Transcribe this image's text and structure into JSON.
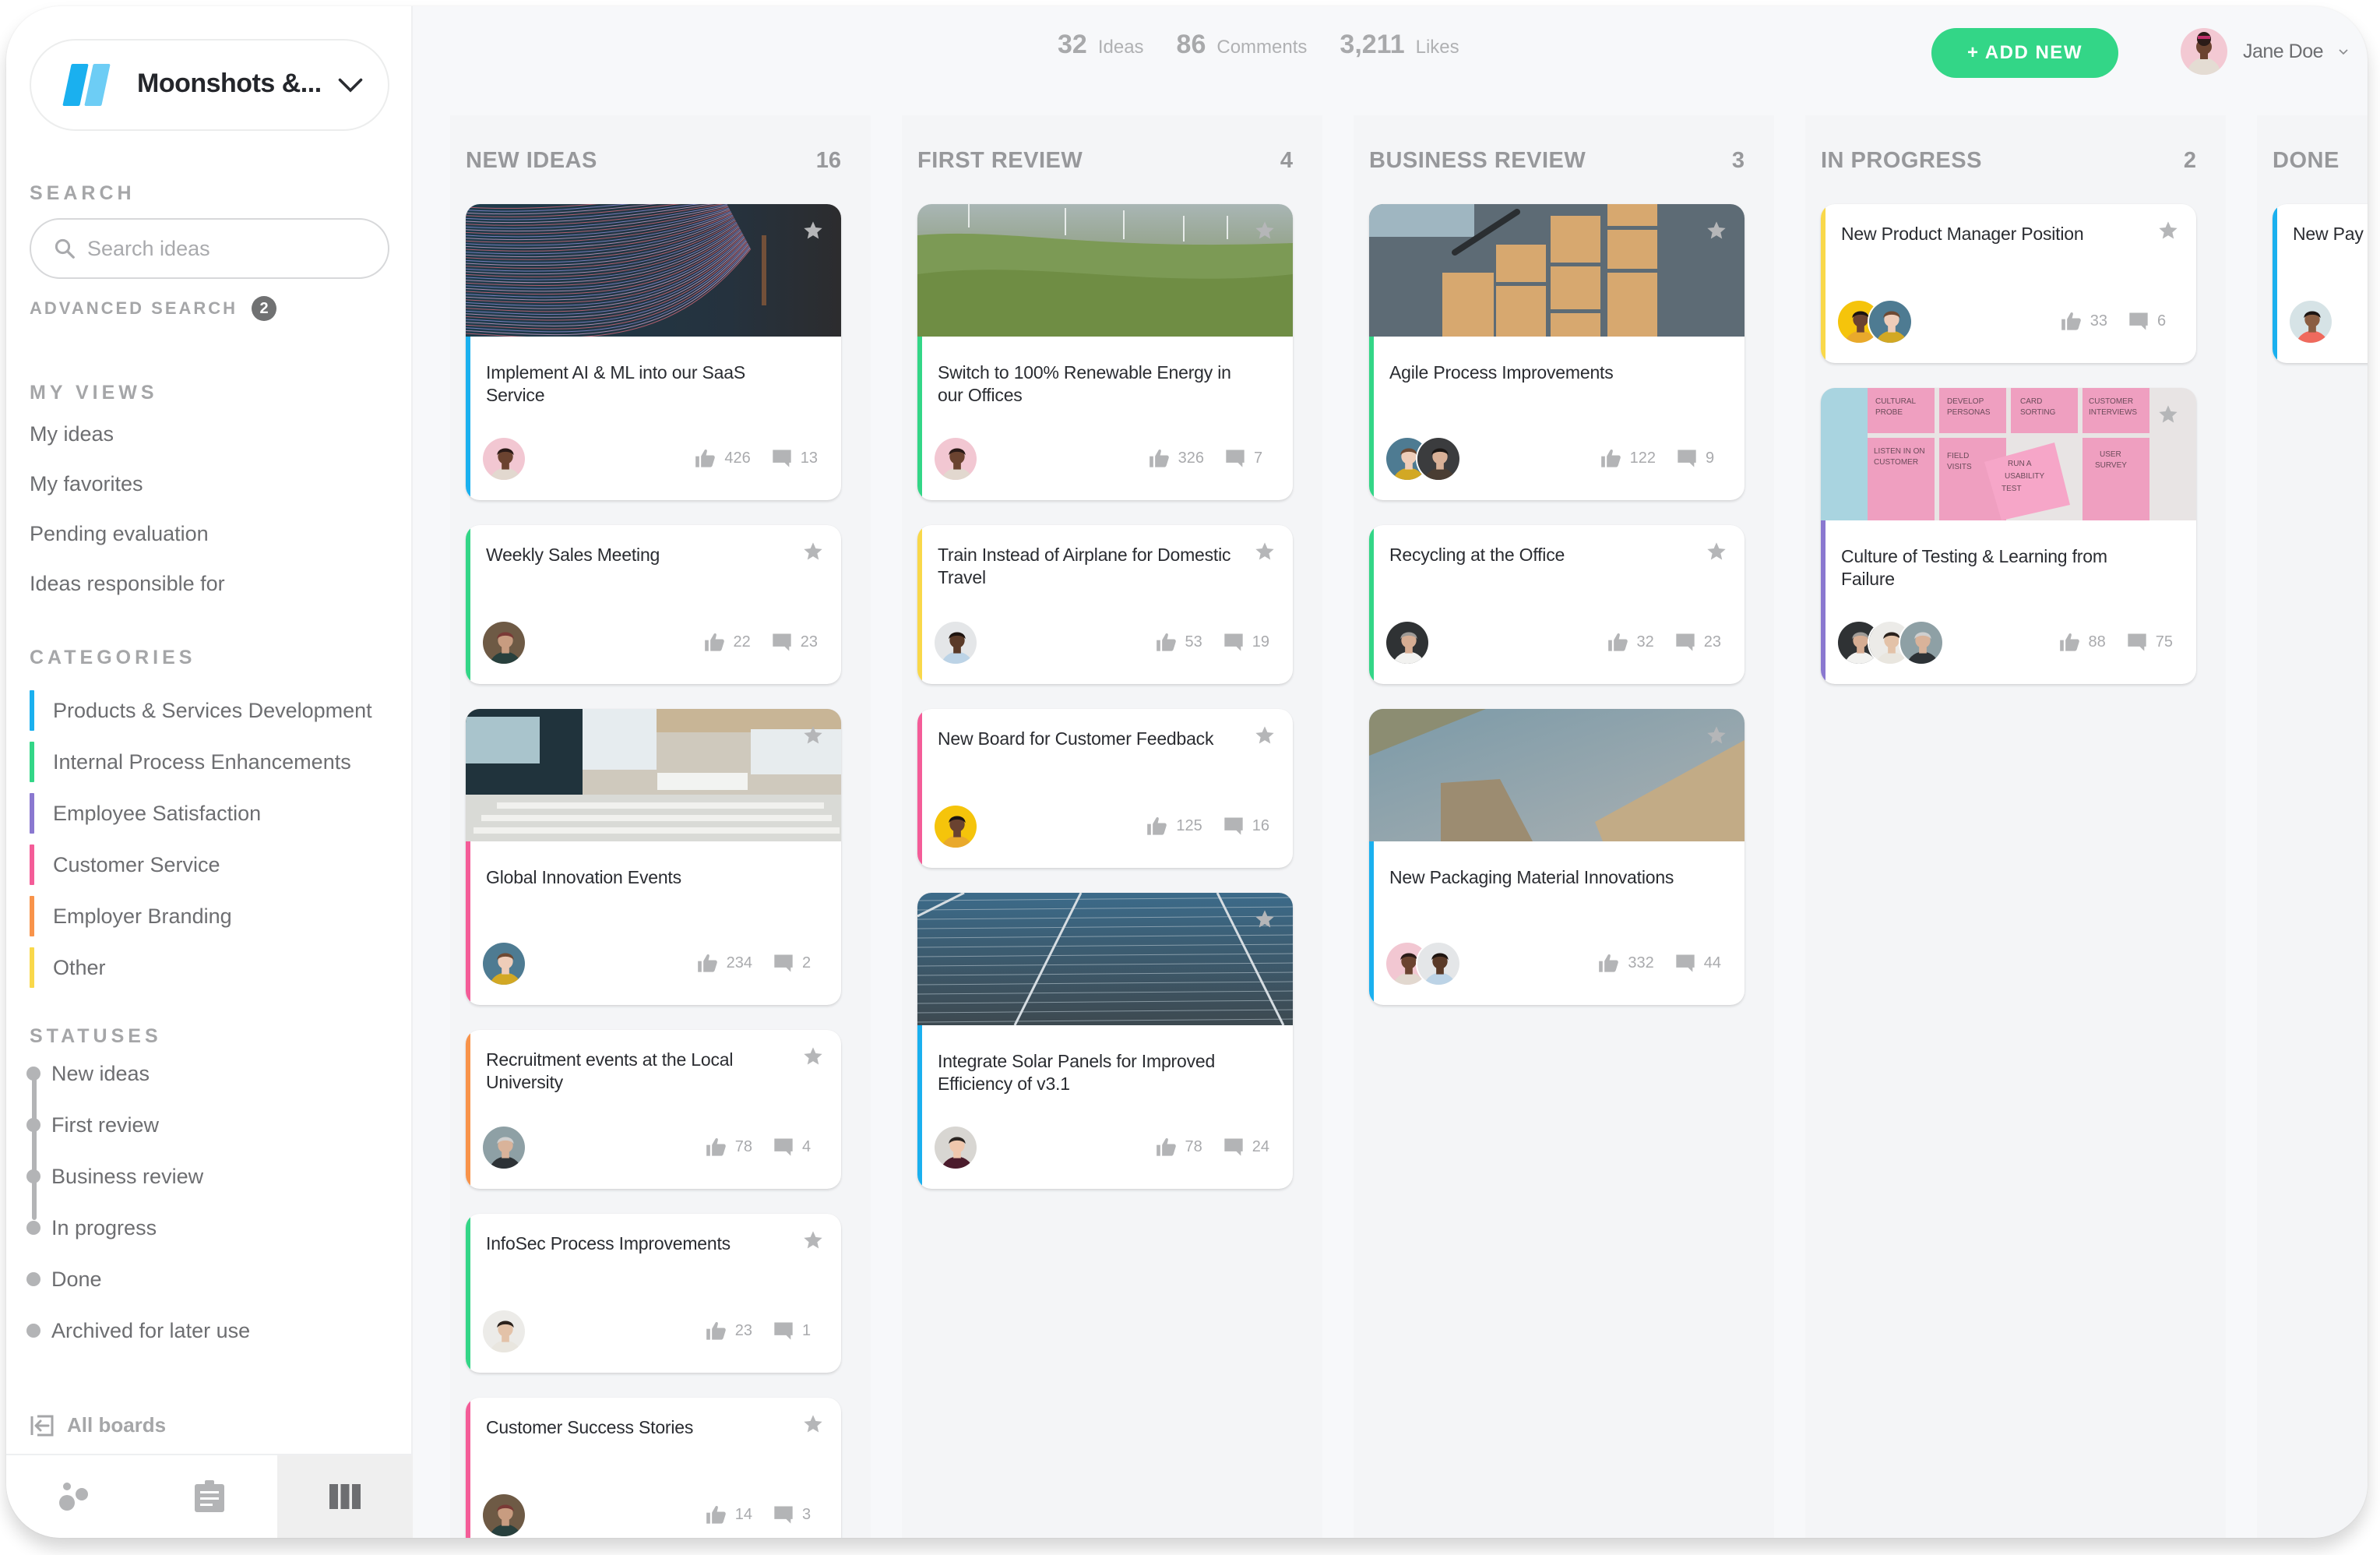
{
  "board": {
    "name": "Moonshots &...",
    "logo_colors": [
      "#1ab0ef",
      "#6dcdf5"
    ]
  },
  "sidebar": {
    "search_heading": "SEARCH",
    "search_placeholder": "Search ideas",
    "search_value": "",
    "advanced_search_label": "ADVANCED SEARCH",
    "advanced_search_count": "2",
    "views_heading": "MY VIEWS",
    "views": [
      "My ideas",
      "My favorites",
      "Pending evaluation",
      "Ideas responsible for"
    ],
    "categories_heading": "CATEGORIES",
    "categories": [
      {
        "label": "Products & Services Development",
        "color": "#1ab0ef"
      },
      {
        "label": "Internal Process Enhancements",
        "color": "#33d687"
      },
      {
        "label": "Employee Satisfaction",
        "color": "#8a78d0"
      },
      {
        "label": "Customer Service",
        "color": "#f45c98"
      },
      {
        "label": "Employer Branding",
        "color": "#f8934a"
      },
      {
        "label": "Other",
        "color": "#f9d84a"
      }
    ],
    "statuses_heading": "STATUSES",
    "statuses": [
      "New ideas",
      "First review",
      "Business review",
      "In progress",
      "Done",
      "Archived for later use"
    ],
    "all_boards_label": "All boards",
    "bottom_tabs": [
      {
        "icon": "community-icon",
        "active": false
      },
      {
        "icon": "clipboard-icon",
        "active": false
      },
      {
        "icon": "board-columns-icon",
        "active": true
      }
    ]
  },
  "topbar": {
    "stats": [
      {
        "value": "32",
        "label": "Ideas"
      },
      {
        "value": "86",
        "label": "Comments"
      },
      {
        "value": "3,211",
        "label": "Likes"
      }
    ],
    "add_new_label": "+ ADD NEW",
    "add_new_color": "#33d687",
    "user_name": "Jane Doe"
  },
  "columns": [
    {
      "title": "NEW IDEAS",
      "count": "16",
      "cards": [
        {
          "title": "Implement AI & ML into our SaaS Service",
          "category_color": "#1ab0ef",
          "image": "abstract-light-lines",
          "likes": "426",
          "comments": "13",
          "avatars": [
            "woman-pink-bg"
          ]
        },
        {
          "title": "Weekly Sales Meeting",
          "category_color": "#33d687",
          "image": null,
          "likes": "22",
          "comments": "23",
          "avatars": [
            "man-beanie"
          ]
        },
        {
          "title": "Global Innovation Events",
          "category_color": "#f45c98",
          "image": "conference-hall",
          "likes": "234",
          "comments": "2",
          "avatars": [
            "woman-blue-bg"
          ]
        },
        {
          "title": "Recruitment events at the Local University",
          "category_color": "#f8934a",
          "image": null,
          "likes": "78",
          "comments": "4",
          "avatars": [
            "woman-grey-hair"
          ]
        },
        {
          "title": "InfoSec Process Improvements",
          "category_color": "#33d687",
          "image": null,
          "likes": "23",
          "comments": "1",
          "avatars": [
            "woman-office"
          ]
        },
        {
          "title": "Customer Success Stories",
          "category_color": "#f45c98",
          "image": null,
          "likes": "14",
          "comments": "3",
          "avatars": [
            "man-beanie"
          ]
        }
      ]
    },
    {
      "title": "FIRST REVIEW",
      "count": "4",
      "cards": [
        {
          "title": "Switch to 100% Renewable Energy in our Offices",
          "category_color": "#33d687",
          "image": "wind-turbines-hills",
          "likes": "326",
          "comments": "7",
          "avatars": [
            "woman-pink-bg"
          ]
        },
        {
          "title": "Train Instead of Airplane for Domestic Travel",
          "category_color": "#f9d84a",
          "image": null,
          "likes": "53",
          "comments": "19",
          "avatars": [
            "man-glasses-light"
          ]
        },
        {
          "title": "New Board for Customer Feedback",
          "category_color": "#f45c98",
          "image": null,
          "likes": "125",
          "comments": "16",
          "avatars": [
            "woman-yellow-bg"
          ]
        },
        {
          "title": "Integrate Solar Panels for Improved Efficiency of v3.1",
          "category_color": "#1ab0ef",
          "image": "solar-panels",
          "likes": "78",
          "comments": "24",
          "avatars": [
            "man-blue-glasses"
          ]
        }
      ]
    },
    {
      "title": "BUSINESS REVIEW",
      "count": "3",
      "cards": [
        {
          "title": "Agile Process Improvements",
          "category_color": "#33d687",
          "image": "sticky-notes-desk",
          "likes": "122",
          "comments": "9",
          "avatars": [
            "woman-blue-bg",
            "man-suit"
          ]
        },
        {
          "title": "Recycling at the Office",
          "category_color": "#33d687",
          "image": null,
          "likes": "32",
          "comments": "23",
          "avatars": [
            "man-grey-beard"
          ]
        },
        {
          "title": "New Packaging Material Innovations",
          "category_color": "#1ab0ef",
          "image": "cardboard-boxes",
          "likes": "332",
          "comments": "44",
          "avatars": [
            "woman-pink-bg",
            "man-glasses-light"
          ]
        }
      ]
    },
    {
      "title": "IN PROGRESS",
      "count": "2",
      "cards": [
        {
          "title": "New Product Manager Position",
          "category_color": "#f9d84a",
          "image": null,
          "likes": "33",
          "comments": "6",
          "avatars": [
            "woman-yellow-bg",
            "woman-blue-bg"
          ]
        },
        {
          "title": "Culture of Testing & Learning from Failure",
          "category_color": "#8a78d0",
          "image": "pink-sticky-notes",
          "likes": "88",
          "comments": "75",
          "avatars": [
            "man-grey-beard",
            "woman-office",
            "woman-grey-hair"
          ]
        }
      ]
    },
    {
      "title": "DONE",
      "count": "",
      "cards": [
        {
          "title": "New Pay",
          "category_color": "#1ab0ef",
          "image": null,
          "likes": "",
          "comments": "",
          "avatars": [
            "man-red-shirt"
          ]
        }
      ]
    }
  ]
}
